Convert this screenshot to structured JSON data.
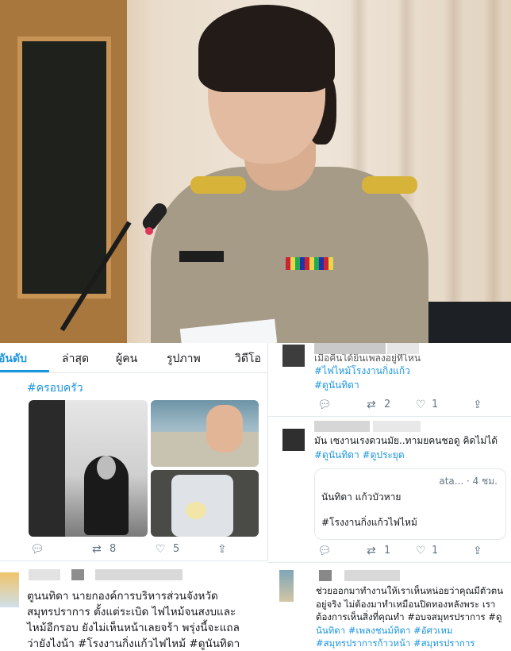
{
  "tabs": [
    "อันดับ",
    "ล่าสุด",
    "ผู้คน",
    "รูปภาพ",
    "วิดีโอ"
  ],
  "left_tweet": {
    "hashtag": "#ครอบครัว",
    "retweets": "8",
    "likes": "5"
  },
  "right_top": {
    "partial_line": "เมื่อคืนได้ยินเพลงอยู่ที่ไหน",
    "line1": "#ไฟไหม้โรงงานกิ่งแก้ว",
    "line2": "#ดูนันทิดา",
    "retweets": "2",
    "likes": "1"
  },
  "right_middle": {
    "line1": "มัน เซงานเรงดวนมัย..ทามยคนชอดู คิดไม่ได้",
    "line2": "#ดูนันทิดา #ดูประยุด",
    "quote_time": "ata... · 4 ชม.",
    "quote_line1": "นันทิดา แก้วบัวหาย",
    "quote_line2": "#โรงงานกิ่งแก้วไฟไหม้",
    "retweets": "1",
    "likes": "1"
  },
  "right_bottom": {
    "lines": [
      "ช่วยออกมาทำงานให้เราเห็นหน่อยว่าคุณมีตัวตน",
      "อยู่จริง ไม่ต้องมาทำเหมือนปิดทองหลังพระ เรา",
      "ต้องการเห็นสิ่งที่คุณทำ #อบจสมุทรปราการ #ดู",
      "นันทิดา #เพลงชนม์ทิดา #อัศวเหม",
      "#สมุทรปราการก้าวหน้า #สมุทรปราการ"
    ]
  },
  "bottom_left": {
    "lines": [
      "ตูนนทิดา  นายกองค์การบริหารส่วนจังหวัด",
      "สมุทรปราการ  ตั้งแต่ระเบิด ไฟไหม้จนสงบและ",
      "ไหม้อีกรอบ ยังไม่เห็นหน้าเลยจร้า  พรุ่งนี้จะแถล",
      "ว่ายังไงน้า #โรงงานกิ่งแก้วไฟไหม้ #ดูนันทิดา"
    ]
  },
  "colors": {
    "link": "#1b95e0",
    "text": "#14171a",
    "muted": "#657786",
    "border": "#e1e8ed"
  }
}
